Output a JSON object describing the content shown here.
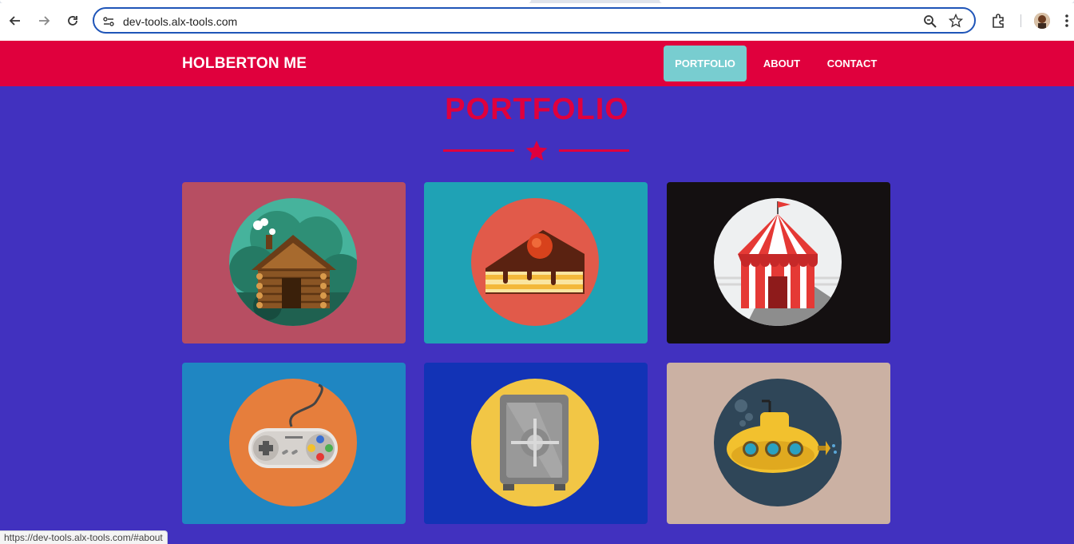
{
  "browser": {
    "url": "dev-tools.alx-tools.com",
    "status_url": "https://dev-tools.alx-tools.com/#about"
  },
  "site": {
    "brand": "HOLBERTON ME",
    "nav": [
      {
        "label": "PORTFOLIO",
        "active": true
      },
      {
        "label": "ABOUT",
        "active": false
      },
      {
        "label": "CONTACT",
        "active": false
      }
    ]
  },
  "section": {
    "title": "PORTFOLIO",
    "divider_icon": "star-icon"
  },
  "portfolio": [
    {
      "icon": "cabin-icon",
      "bg": "#b74e62"
    },
    {
      "icon": "cake-icon",
      "bg": "#1fa2b5"
    },
    {
      "icon": "circus-tent-icon",
      "bg": "#141011"
    },
    {
      "icon": "game-controller-icon",
      "bg": "#1f86c2"
    },
    {
      "icon": "safe-icon",
      "bg": "#1233b6"
    },
    {
      "icon": "submarine-icon",
      "bg": "#cbb1a3"
    }
  ],
  "colors": {
    "page_bg": "#4131bf",
    "header_bg": "#e0003d",
    "accent": "#e0003d",
    "active_nav_bg": "#78cdd0"
  }
}
